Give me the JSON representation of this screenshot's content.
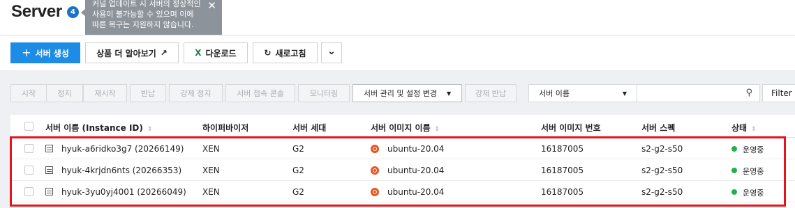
{
  "header": {
    "title": "Server",
    "badge": "4",
    "tooltip_text": "커널 업데이트 시 서버의 정상적인\n사용이 불가능할 수 있으며 이에\n따른 복구는 지원하지 않습니다.",
    "tooltip_close": "✕"
  },
  "toolbar": {
    "create_icon": "+",
    "create_label": "서버 생성",
    "more_label": "상품 더 알아보기",
    "more_icon": "↗",
    "download_icon": "X",
    "download_label": "다운로드",
    "refresh_icon": "↻",
    "refresh_label": "새로고침",
    "caret": "⌄"
  },
  "actions": {
    "start": "시작",
    "stop": "정지",
    "restart": "재시작",
    "return": "반납",
    "force_stop": "강제 정지",
    "console": "서버 접속 콘솔",
    "monitoring": "모니터링",
    "manage": "서버 관리 및 설정 변경",
    "manage_caret": "▼",
    "force_return": "강제 반납"
  },
  "search": {
    "select_value": "서버 이름",
    "select_caret": "▼",
    "search_icon": "⚲",
    "filter_label": "Filter"
  },
  "table": {
    "columns": {
      "name": "서버 이름 (Instance ID)",
      "hypervisor": "하이퍼바이저",
      "generation": "서버 세대",
      "image_name": "서버 이미지 이름",
      "image_no": "서버 이미지 번호",
      "spec": "서버 스펙",
      "status": "상태"
    },
    "sort_icon": "⇕",
    "rows": [
      {
        "name": "hyuk-a6ridko3g7 (20266149)",
        "hypervisor": "XEN",
        "generation": "G2",
        "image_name": "ubuntu-20.04",
        "image_no": "16187005",
        "spec": "s2-g2-s50",
        "status": "운영중"
      },
      {
        "name": "hyuk-4krjdn6nts (20266353)",
        "hypervisor": "XEN",
        "generation": "G2",
        "image_name": "ubuntu-20.04",
        "image_no": "16187005",
        "spec": "s2-g2-s50",
        "status": "운영중"
      },
      {
        "name": "hyuk-3yu0yj4001 (20266049)",
        "hypervisor": "XEN",
        "generation": "G2",
        "image_name": "ubuntu-20.04",
        "image_no": "16187005",
        "spec": "s2-g2-s50",
        "status": "운영중"
      }
    ]
  },
  "colors": {
    "primary": "#1c8ce6",
    "status_running": "#21b24b",
    "highlight": "#e4141b",
    "ubuntu": "#e95420"
  }
}
